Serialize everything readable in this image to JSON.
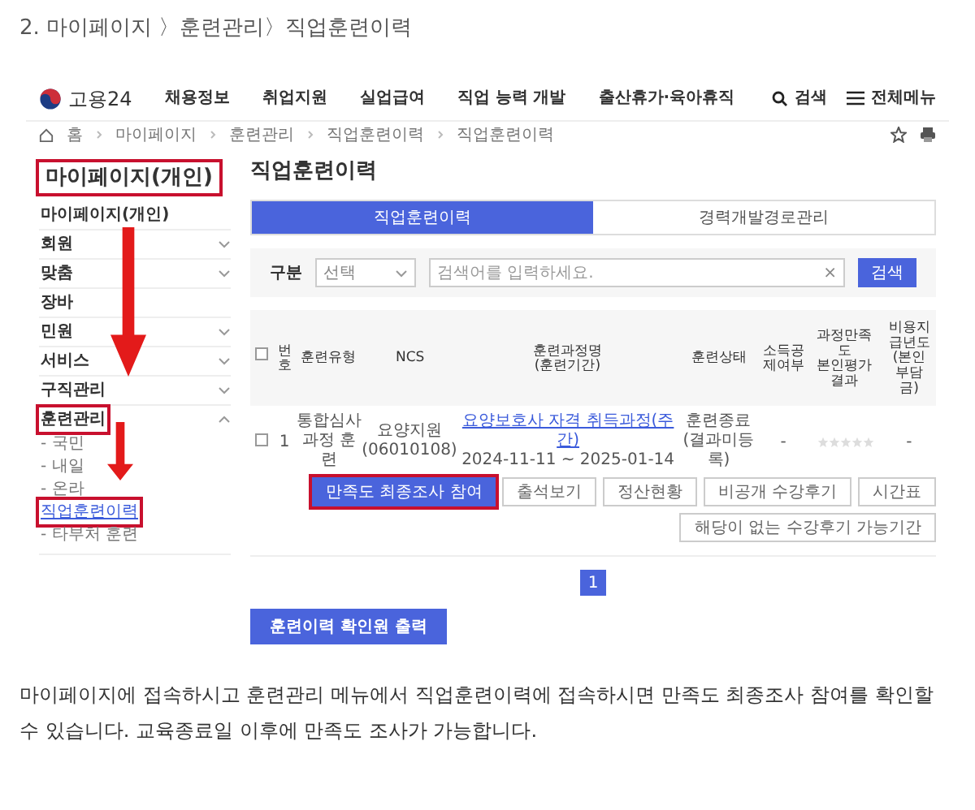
{
  "post_heading": "2. 마이페이지 〉훈련관리〉직업훈련이력",
  "site": {
    "logo": "고용24",
    "nav": [
      "채용정보",
      "취업지원",
      "실업급여",
      "직업 능력 개발",
      "출산휴가·육아휴직"
    ],
    "search": "검색",
    "all_menu": "전체메뉴",
    "breadcrumb": [
      "홈",
      "마이페이지",
      "훈련관리",
      "직업훈련이력",
      "직업훈련이력"
    ]
  },
  "sidebar": {
    "title": "마이페이지(개인)",
    "title_highlighted": true,
    "items": [
      {
        "label": "마이페이지(개인)"
      },
      {
        "label": "회원",
        "expanded": false
      },
      {
        "label": "맞춤",
        "expanded": false
      },
      {
        "label": "장바"
      },
      {
        "label": "민원",
        "expanded": false
      },
      {
        "label": "서비스",
        "expanded": false
      },
      {
        "label": "구직관리",
        "expanded": false
      },
      {
        "label": "훈련관리",
        "expanded": true,
        "highlighted": true,
        "children": [
          {
            "label": "- 국민",
            "selected": false,
            "highlighted": false
          },
          {
            "label": "- 내일",
            "selected": false,
            "highlighted": false
          },
          {
            "label": "- 온라",
            "selected": false,
            "highlighted": false
          },
          {
            "label": "직업훈련이력",
            "selected": true,
            "highlighted": true
          },
          {
            "label": "- 타부처 훈련",
            "selected": false,
            "highlighted": false
          }
        ]
      }
    ]
  },
  "main": {
    "title": "직업훈련이력",
    "tabs": [
      {
        "label": "직업훈련이력",
        "selected": true
      },
      {
        "label": "경력개발경로관리",
        "selected": false
      }
    ],
    "filter": {
      "label": "구분",
      "select": "선택",
      "placeholder": "검색어를 입력하세요.",
      "clear": "×",
      "button": "검색"
    },
    "table": {
      "select_all_checked": false,
      "columns": [
        "번호",
        "훈련유형",
        "NCS",
        "훈련과정명\n(훈련기간)",
        "훈련상태",
        "소득공제여부",
        "과정만족도\n본인평가결과",
        "비용지급년도\n(본인부담금)"
      ],
      "rows": [
        {
          "checked": false,
          "no": "1",
          "type": "통합심사과정 훈련",
          "ncs": "요양지원\n(06010108)",
          "course": "요양보호사 자격 취득과정(주간)",
          "period": "2024-11-11 ~ 2025-01-14",
          "status": "훈련종료(결과미등록)",
          "tax": "-",
          "stars": 0,
          "cost": "-",
          "actions": [
            {
              "label": "만족도 최종조사 참여",
              "kind": "primary",
              "highlighted": true
            },
            {
              "label": "출석보기",
              "kind": "outline",
              "highlighted": false
            },
            {
              "label": "정산현황",
              "kind": "outline",
              "highlighted": false
            },
            {
              "label": "비공개 수강후기",
              "kind": "outline",
              "highlighted": false
            },
            {
              "label": "시간표",
              "kind": "outline",
              "highlighted": false
            },
            {
              "label": "해당이 없는 수강후기 가능기간",
              "kind": "outline",
              "highlighted": false
            }
          ]
        }
      ]
    },
    "pages": [
      {
        "label": "1",
        "selected": true
      }
    ],
    "print_button": "훈련이력 확인원 출력"
  },
  "post_body": "마이페이지에 접속하시고 훈련관리 메뉴에서 직업훈련이력에 접속하시면 만족도 최종조사 참여를 확인할 수 있습니다. 교육종료일 이후에  만족도 조사가 가능합니다."
}
